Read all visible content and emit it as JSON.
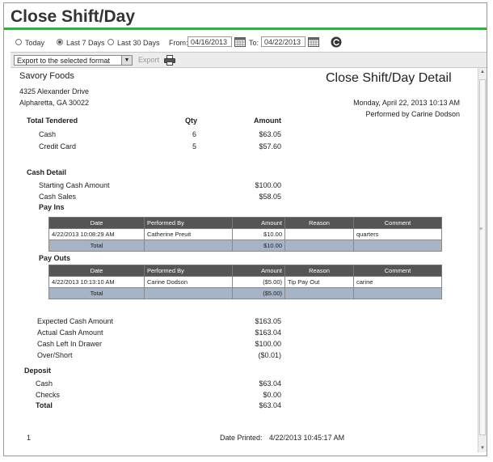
{
  "page_title": "Close Shift/Day",
  "filters": {
    "today_label": "Today",
    "last7_label": "Last 7 Days",
    "last30_label": "Last 30 Days",
    "selected": "Last 7 Days",
    "from_label": "From:",
    "from_value": "04/16/2013",
    "to_label": "To:",
    "to_value": "04/22/2013"
  },
  "toolbar": {
    "export_select_value": "Export to the selected format",
    "export_label": "Export"
  },
  "report": {
    "company": "Savory Foods",
    "address1": "4325 Alexander Drive",
    "address2": "Alpharetta, GA 30022",
    "report_title": "Close Shift/Day Detail",
    "date": "Monday, April 22, 2013 10:13 AM",
    "performed_by": "Performed by Carine Dodson",
    "total_tendered": {
      "heading": "Total Tendered",
      "qty_header": "Qty",
      "amount_header": "Amount",
      "rows": [
        {
          "label": "Cash",
          "qty": "6",
          "amount": "$63.05"
        },
        {
          "label": "Credit Card",
          "qty": "5",
          "amount": "$57.60"
        }
      ]
    },
    "cash_detail": {
      "heading": "Cash Detail",
      "starting_label": "Starting Cash Amount",
      "starting_value": "$100.00",
      "sales_label": "Cash Sales",
      "sales_value": "$58.05"
    },
    "table_headers": [
      "Date",
      "Performed By",
      "Amount",
      "Reason",
      "Comment"
    ],
    "pay_ins": {
      "heading": "Pay Ins",
      "row": {
        "date": "4/22/2013 10:08:29 AM",
        "by": "Catherine Preuit",
        "amount": "$10.00",
        "reason": "",
        "comment": "quarters"
      },
      "total_label": "Total",
      "total_amount": "$10.00"
    },
    "pay_outs": {
      "heading": "Pay Outs",
      "row": {
        "date": "4/22/2013 10:13:10 AM",
        "by": "Carine Dodson",
        "amount": "($5.00)",
        "reason": "Tip Pay Out",
        "comment": "carine"
      },
      "total_label": "Total",
      "total_amount": "($5.00)"
    },
    "summary": [
      {
        "label": "Expected Cash Amount",
        "value": "$163.05"
      },
      {
        "label": "Actual Cash Amount",
        "value": "$163.04"
      },
      {
        "label": "Cash Left In Drawer",
        "value": "$100.00"
      },
      {
        "label": "Over/Short",
        "value": "($0.01)"
      }
    ],
    "deposit": {
      "heading": "Deposit",
      "cash_label": "Cash",
      "cash_value": "$63.04",
      "checks_label": "Checks",
      "checks_value": "$0.00",
      "total_label": "Total",
      "total_value": "$63.04"
    },
    "footer": {
      "page_number": "1",
      "printed_label": "Date Printed:",
      "printed_value": "4/22/2013 10:45:17 AM"
    }
  }
}
